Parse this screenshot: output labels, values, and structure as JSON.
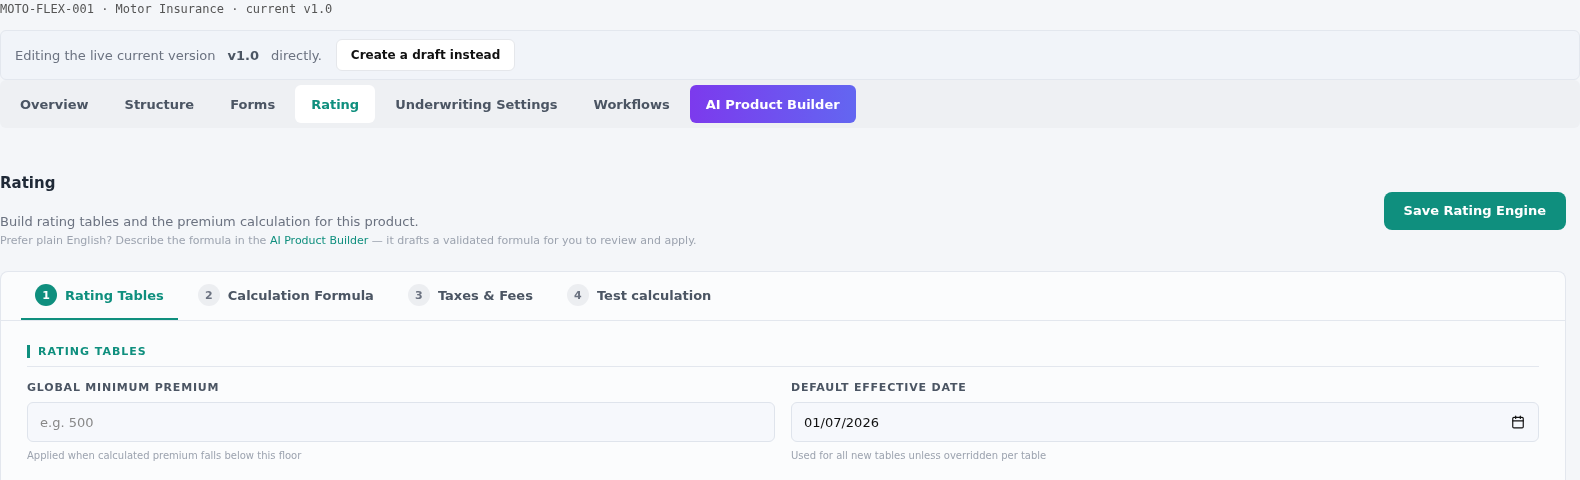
{
  "breadcrumb": "MOTO-FLEX-001 · Motor Insurance · current v1.0",
  "banner": {
    "text_before": "Editing the live current version",
    "version": "v1.0",
    "text_after": "directly.",
    "button": "Create a draft instead"
  },
  "tabs": [
    {
      "label": "Overview",
      "selected": false,
      "kind": "plain"
    },
    {
      "label": "Structure",
      "selected": false,
      "kind": "plain"
    },
    {
      "label": "Forms",
      "selected": false,
      "kind": "plain"
    },
    {
      "label": "Rating",
      "selected": true,
      "kind": "plain"
    },
    {
      "label": "Underwriting Settings",
      "selected": false,
      "kind": "plain"
    },
    {
      "label": "Workflows",
      "selected": false,
      "kind": "plain"
    },
    {
      "label": "AI Product Builder",
      "selected": false,
      "kind": "highlight"
    }
  ],
  "page": {
    "title": "Rating",
    "description": "Build rating tables and the premium calculation for this product.",
    "hint_before": "Prefer plain English? Describe the formula in the",
    "hint_link": "AI Product Builder",
    "hint_after": "— it drafts a validated formula for you to review and apply.",
    "save_button": "Save Rating Engine"
  },
  "steps": [
    {
      "number": "1",
      "label": "Rating Tables",
      "selected": true
    },
    {
      "number": "2",
      "label": "Calculation Formula",
      "selected": false
    },
    {
      "number": "3",
      "label": "Taxes & Fees",
      "selected": false
    },
    {
      "number": "4",
      "label": "Test calculation",
      "selected": false
    }
  ],
  "section": {
    "title": "RATING TABLES",
    "fields": [
      {
        "label": "GLOBAL MINIMUM PREMIUM",
        "kind": "text",
        "placeholder": "e.g. 500",
        "help": "Applied when calculated premium falls below this floor"
      },
      {
        "label": "DEFAULT EFFECTIVE DATE",
        "kind": "date",
        "value": "01/07/2026",
        "help": "Used for all new tables unless overridden per table"
      }
    ]
  }
}
